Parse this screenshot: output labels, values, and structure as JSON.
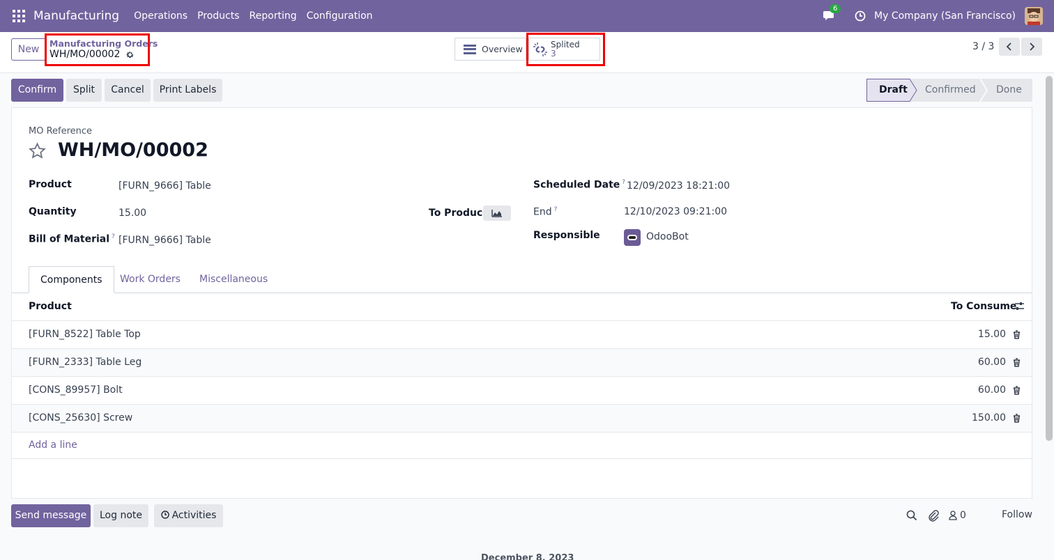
{
  "nav": {
    "brand": "Manufacturing",
    "menu": [
      "Operations",
      "Products",
      "Reporting",
      "Configuration"
    ],
    "chat_badge": "6",
    "company": "My Company (San Francisco)"
  },
  "control_panel": {
    "new_label": "New",
    "breadcrumb_parent": "Manufacturing Orders",
    "breadcrumb_current": "WH/MO/00002",
    "overview_label": "Overview",
    "split_label": "Splited",
    "split_value": "3",
    "pager": "3 / 3"
  },
  "actions": {
    "confirm": "Confirm",
    "split": "Split",
    "cancel": "Cancel",
    "print_labels": "Print Labels"
  },
  "statusbar": {
    "stages": [
      "Draft",
      "Confirmed",
      "Done"
    ],
    "active": "Draft"
  },
  "form": {
    "ref_label": "MO Reference",
    "ref_value": "WH/MO/00002",
    "product_label": "Product",
    "product_value": "[FURN_9666] Table",
    "quantity_label": "Quantity",
    "quantity_value": "15.00",
    "to_produce_label": "To Produce",
    "bom_label": "Bill of Material",
    "bom_value": "[FURN_9666] Table",
    "scheduled_label": "Scheduled Date",
    "scheduled_value": "12/09/2023 18:21:00",
    "end_label": "End",
    "end_value": "12/10/2023 09:21:00",
    "responsible_label": "Responsible",
    "responsible_value": "OdooBot",
    "help_mark": "?"
  },
  "tabs": [
    "Components",
    "Work Orders",
    "Miscellaneous"
  ],
  "table": {
    "headers": {
      "product": "Product",
      "to_consume": "To Consume"
    },
    "rows": [
      {
        "product": "[FURN_8522] Table Top",
        "qty": "15.00"
      },
      {
        "product": "[FURN_2333] Table Leg",
        "qty": "60.00"
      },
      {
        "product": "[CONS_89957] Bolt",
        "qty": "60.00"
      },
      {
        "product": "[CONS_25630] Screw",
        "qty": "150.00"
      }
    ],
    "add_line": "Add a line"
  },
  "chatter": {
    "send_message": "Send message",
    "log_note": "Log note",
    "activities": "Activities",
    "followers": "0",
    "follow": "Follow",
    "date_separator": "December 8, 2023"
  },
  "colors": {
    "primary": "#71639e",
    "highlight_box": "#ee0000"
  }
}
